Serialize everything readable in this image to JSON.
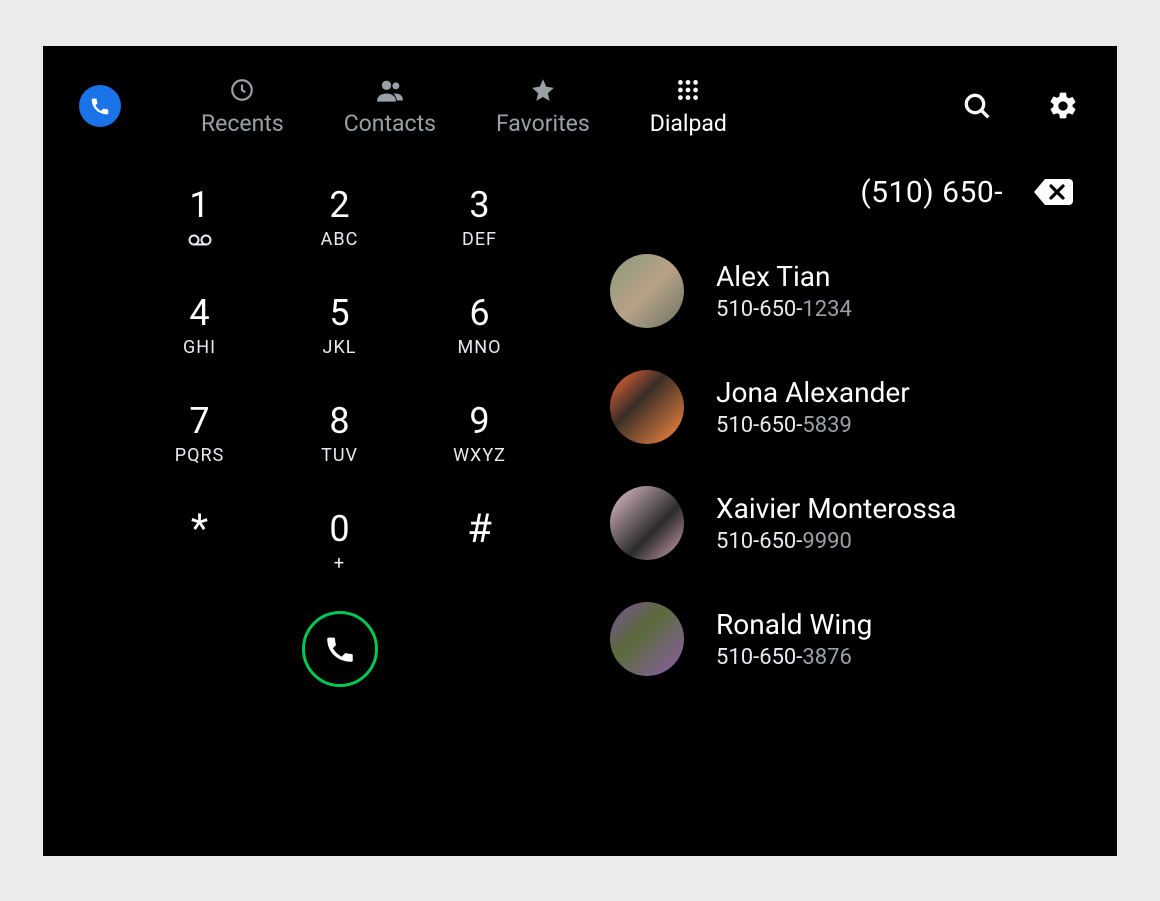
{
  "tabs": [
    {
      "id": "recents",
      "label": "Recents",
      "active": false
    },
    {
      "id": "contacts",
      "label": "Contacts",
      "active": false
    },
    {
      "id": "favorites",
      "label": "Favorites",
      "active": false
    },
    {
      "id": "dialpad",
      "label": "Dialpad",
      "active": true
    }
  ],
  "dialpad": {
    "keys": [
      {
        "digit": "1",
        "letters": "voicemail-icon"
      },
      {
        "digit": "2",
        "letters": "ABC"
      },
      {
        "digit": "3",
        "letters": "DEF"
      },
      {
        "digit": "4",
        "letters": "GHI"
      },
      {
        "digit": "5",
        "letters": "JKL"
      },
      {
        "digit": "6",
        "letters": "MNO"
      },
      {
        "digit": "7",
        "letters": "PQRS"
      },
      {
        "digit": "8",
        "letters": "TUV"
      },
      {
        "digit": "9",
        "letters": "WXYZ"
      },
      {
        "digit": "*",
        "letters": ""
      },
      {
        "digit": "0",
        "letters": "+"
      },
      {
        "digit": "#",
        "letters": ""
      }
    ]
  },
  "dialed_number": "(510) 650-",
  "matched_prefix": "510-650-",
  "contacts": [
    {
      "name": "Alex Tian",
      "suffix": "1234",
      "avatar_bg": "linear-gradient(135deg,#8a9a7b 0%,#b8a188 50%,#6b7563 100%)"
    },
    {
      "name": "Jona Alexander",
      "suffix": "5839",
      "avatar_bg": "linear-gradient(135deg,#ff6b35 0%,#3a2e28 40%,#ff8c42 100%)"
    },
    {
      "name": "Xaivier Monterossa",
      "suffix": "9990",
      "avatar_bg": "linear-gradient(135deg,#e8c5d0 0%,#2b2b2b 60%,#d4a5b8 100%)"
    },
    {
      "name": "Ronald Wing",
      "suffix": "3876",
      "avatar_bg": "linear-gradient(135deg,#7b4f9e 0%,#5a6b3a 40%,#8b5fa8 100%)"
    }
  ],
  "colors": {
    "accent": "#1a73e8",
    "call_green": "#00c853",
    "muted": "#9aa0a6"
  }
}
